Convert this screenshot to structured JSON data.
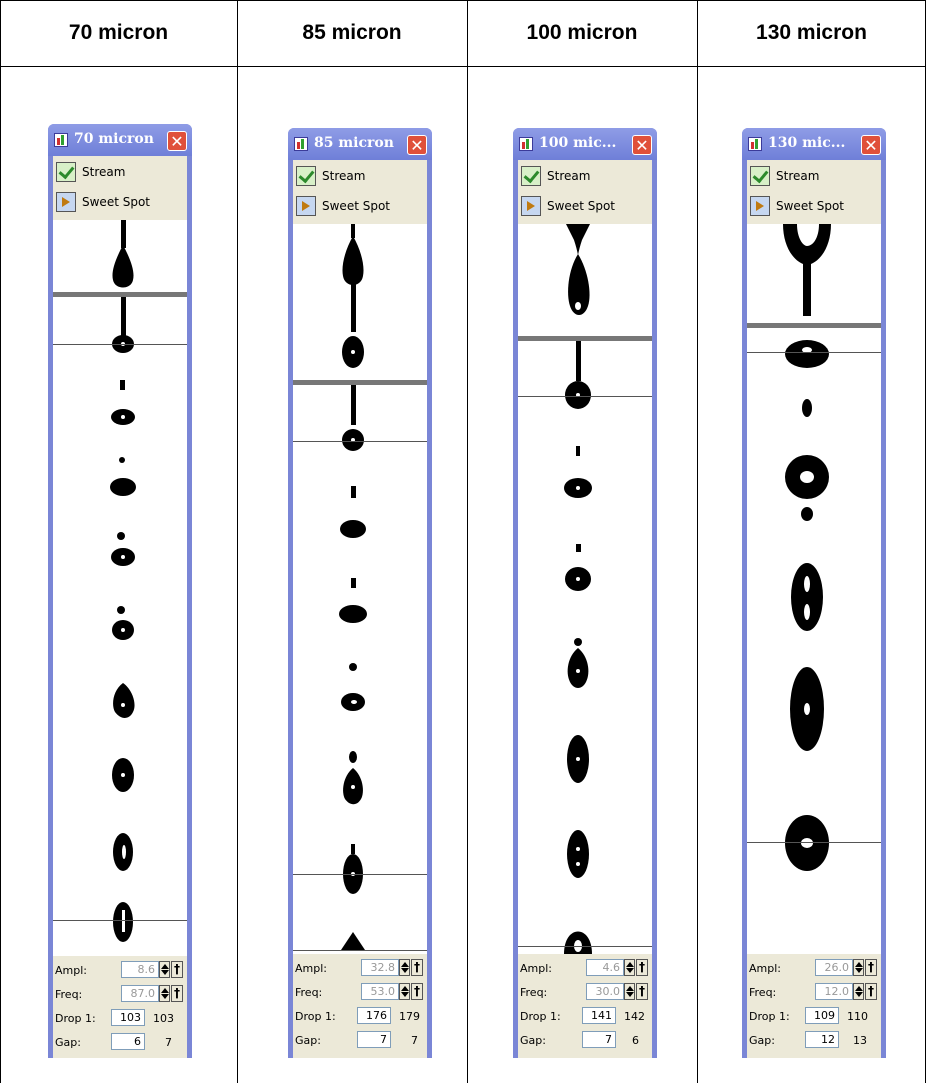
{
  "columns": [
    {
      "header": "70 micron",
      "window_title": "70 micron",
      "menu": {
        "stream_label": "Stream",
        "sweet_spot_label": "Sweet Spot"
      },
      "ampl": {
        "label": "Ampl:",
        "value": "8.6"
      },
      "freq": {
        "label": "Freq:",
        "value": "87.0"
      },
      "drop1": {
        "label": "Drop 1:",
        "value": "103",
        "readout": "103"
      },
      "gap": {
        "label": "Gap:",
        "value": "6",
        "readout": "7"
      }
    },
    {
      "header": "85 micron",
      "window_title": "85 micron",
      "menu": {
        "stream_label": "Stream",
        "sweet_spot_label": "Sweet Spot"
      },
      "ampl": {
        "label": "Ampl:",
        "value": "32.8"
      },
      "freq": {
        "label": "Freq:",
        "value": "53.0"
      },
      "drop1": {
        "label": "Drop 1:",
        "value": "176",
        "readout": "179"
      },
      "gap": {
        "label": "Gap:",
        "value": "7",
        "readout": "7"
      }
    },
    {
      "header": "100 micron",
      "window_title": "100 mic...",
      "menu": {
        "stream_label": "Stream",
        "sweet_spot_label": "Sweet Spot"
      },
      "ampl": {
        "label": "Ampl:",
        "value": "4.6"
      },
      "freq": {
        "label": "Freq:",
        "value": "30.0"
      },
      "drop1": {
        "label": "Drop 1:",
        "value": "141",
        "readout": "142"
      },
      "gap": {
        "label": "Gap:",
        "value": "7",
        "readout": "6"
      }
    },
    {
      "header": "130 micron",
      "window_title": "130 mic...",
      "menu": {
        "stream_label": "Stream",
        "sweet_spot_label": "Sweet Spot"
      },
      "ampl": {
        "label": "Ampl:",
        "value": "26.0"
      },
      "freq": {
        "label": "Freq:",
        "value": "12.0"
      },
      "drop1": {
        "label": "Drop 1:",
        "value": "109",
        "readout": "110"
      },
      "gap": {
        "label": "Gap:",
        "value": "12",
        "readout": "13"
      }
    }
  ],
  "icons": {
    "title_icon": "app-chart-icon",
    "close": "close-icon",
    "stream": "checkmark-icon",
    "sweet_spot": "sweet-spot-icon",
    "spin": "spinner-arrows-icon",
    "lock": "pin-icon"
  },
  "colors": {
    "window_frame": "#7a86d6",
    "close_button": "#e0503a",
    "panel_bg": "#ece9d8"
  }
}
